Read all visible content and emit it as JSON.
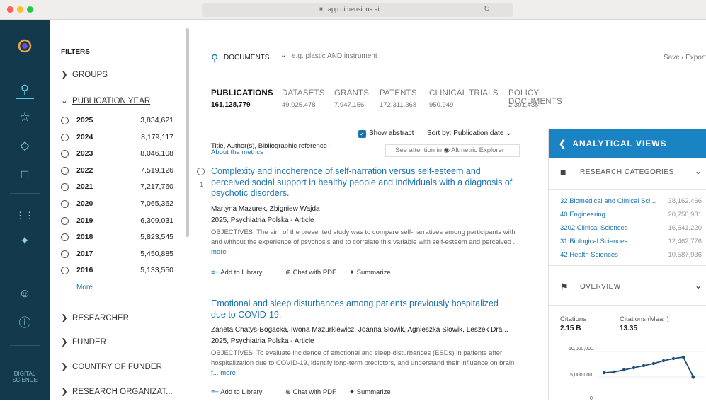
{
  "browser": {
    "url": "app.dimensions.ai",
    "shield_icon": "shield-icon",
    "reload_icon": "reload-icon"
  },
  "nav": {
    "brand_line1": "DIGITAL",
    "brand_line2": "SCIENCE"
  },
  "filters": {
    "heading": "FILTERS",
    "groups": "GROUPS",
    "publication_year": "PUBLICATION YEAR",
    "years": [
      {
        "year": "2025",
        "count": "3,834,621"
      },
      {
        "year": "2024",
        "count": "8,179,117"
      },
      {
        "year": "2023",
        "count": "8,046,108"
      },
      {
        "year": "2022",
        "count": "7,519,126"
      },
      {
        "year": "2021",
        "count": "7,217,760"
      },
      {
        "year": "2020",
        "count": "7,065,362"
      },
      {
        "year": "2019",
        "count": "6,309,031"
      },
      {
        "year": "2018",
        "count": "5,823,545"
      },
      {
        "year": "2017",
        "count": "5,450,885"
      },
      {
        "year": "2016",
        "count": "5,133,550"
      }
    ],
    "more": "More",
    "researcher": "RESEARCHER",
    "funder": "FUNDER",
    "country_of_funder": "COUNTRY OF FUNDER",
    "research_org": "RESEARCH ORGANIZAT..."
  },
  "search": {
    "scope": "DOCUMENTS",
    "placeholder": "e.g. plastic AND instrument",
    "save_export": "Save / Export"
  },
  "tabs": [
    {
      "label": "PUBLICATIONS",
      "count": "161,128,779"
    },
    {
      "label": "DATASETS",
      "count": "49,025,478"
    },
    {
      "label": "GRANTS",
      "count": "7,947,156"
    },
    {
      "label": "PATENTS",
      "count": "172,311,368"
    },
    {
      "label": "CLINICAL TRIALS",
      "count": "950,949"
    },
    {
      "label": "POLICY DOCUMENTS",
      "count": "2,301,436"
    }
  ],
  "list_controls": {
    "show_abstract": "Show abstract",
    "sort_by": "Sort by: Publication date",
    "columns": "Title, Author(s), Bibliographic reference -",
    "about_metrics": "About the metrics",
    "altmetric": "See attention in",
    "altmetric_explorer": "Altmetric Explorer"
  },
  "results": [
    {
      "index": "1",
      "title": "Complexity and incoherence of self-narration versus self-esteem and perceived social support in healthy people and individuals with a diagnosis of psychotic disorders.",
      "authors": "Martyna Mazurek, Zbigniew Wajda",
      "source": "2025, Psychiatria Polska - Article",
      "abstract": "OBJECTIVES: The aim of the presented study was to compare self-narratives among participants with and without the experience of psychosis and to correlate this variable with self-esteem and perceived ...",
      "more": "more"
    },
    {
      "title": "Emotional and sleep disturbances among patients previously hospitalized due to COVID-19.",
      "authors": "Zaneta Chatys-Bogacka, Iwona Mazurkiewicz, Joanna Słowik, Agnieszka Słowik, Leszek Dra...",
      "source": "2025, Psychiatria Polska - Article",
      "abstract": "OBJECTIVES: To evaluate incidence of emotional and sleep disturbances (ESDs) in patients after hospitalization due to COVID-19, identify long-term predictors, and understand their influence on brain f...",
      "more": "more"
    }
  ],
  "actions": {
    "add_library": "Add to Library",
    "chat_pdf": "Chat with PDF",
    "summarize": "Summarize"
  },
  "panel": {
    "title": "ANALYTICAL VIEWS",
    "research_categories": "RESEARCH CATEGORIES",
    "categories": [
      {
        "name": "32 Biomedical and Clinical Sci...",
        "count": "38,162,466"
      },
      {
        "name": "40 Engineering",
        "count": "20,750,981"
      },
      {
        "name": "3202 Clinical Sciences",
        "count": "16,641,220"
      },
      {
        "name": "31 Biological Sciences",
        "count": "12,462,776"
      },
      {
        "name": "42 Health Sciences",
        "count": "10,587,936"
      }
    ],
    "overview": "OVERVIEW",
    "citations_label": "Citations",
    "citations_value": "2.15 B",
    "citations_mean_label": "Citations (Mean)",
    "citations_mean_value": "13.35",
    "y_ticks": [
      "10,000,000",
      "5,000,000",
      "0"
    ]
  },
  "colors": {
    "nav_bg": "#123a4c",
    "accent": "#1a83c4",
    "link": "#1a73ae"
  }
}
